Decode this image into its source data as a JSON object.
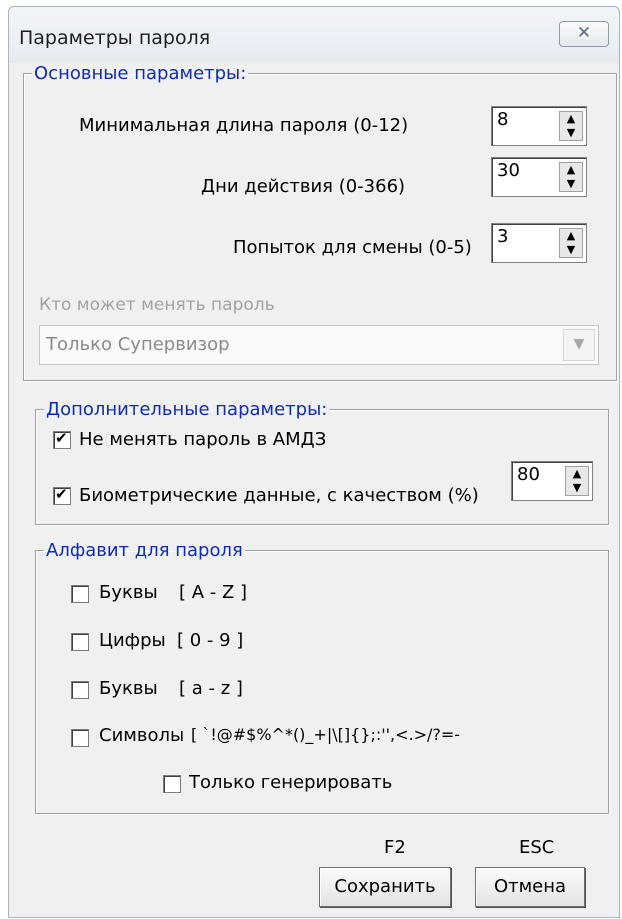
{
  "window": {
    "title": "Параметры пароля",
    "close_icon": "close-icon"
  },
  "main_group": {
    "legend": "Основные параметры:",
    "min_length": {
      "label": "Минимальная длина пароля (0-12)",
      "value": "8"
    },
    "valid_days": {
      "label": "Дни действия (0-366)",
      "value": "30"
    },
    "change_attempts": {
      "label": "Попыток для смены (0-5)",
      "value": "3"
    },
    "who_can_change_label": "Кто может менять пароль",
    "who_can_change_value": "Только Супервизор"
  },
  "extra_group": {
    "legend": "Дополнительные параметры:",
    "no_change_amdz": {
      "label": "Не менять пароль в АМДЗ",
      "checked": true
    },
    "biometric": {
      "label": "Биометрические данные, с качеством (%)",
      "checked": true,
      "value": "80"
    }
  },
  "alphabet_group": {
    "legend": "Алфавит для пароля",
    "upper": {
      "label": "Буквы",
      "range": "[ A - Z ]",
      "checked": false
    },
    "digits": {
      "label": "Цифры",
      "range": "[ 0 - 9 ]",
      "checked": false
    },
    "lower": {
      "label": "Буквы",
      "range": "[ a - z ]",
      "checked": false
    },
    "symbols": {
      "label": "Символы",
      "range": "[ `!@#$%^*()_+|\\[]{};:'',<.>/?=-",
      "checked": false
    },
    "generate_only": {
      "label": "Только генерировать",
      "checked": false
    }
  },
  "footer": {
    "save_hotkey": "F2",
    "cancel_hotkey": "ESC",
    "save_label": "Сохранить",
    "cancel_label": "Отмена"
  }
}
